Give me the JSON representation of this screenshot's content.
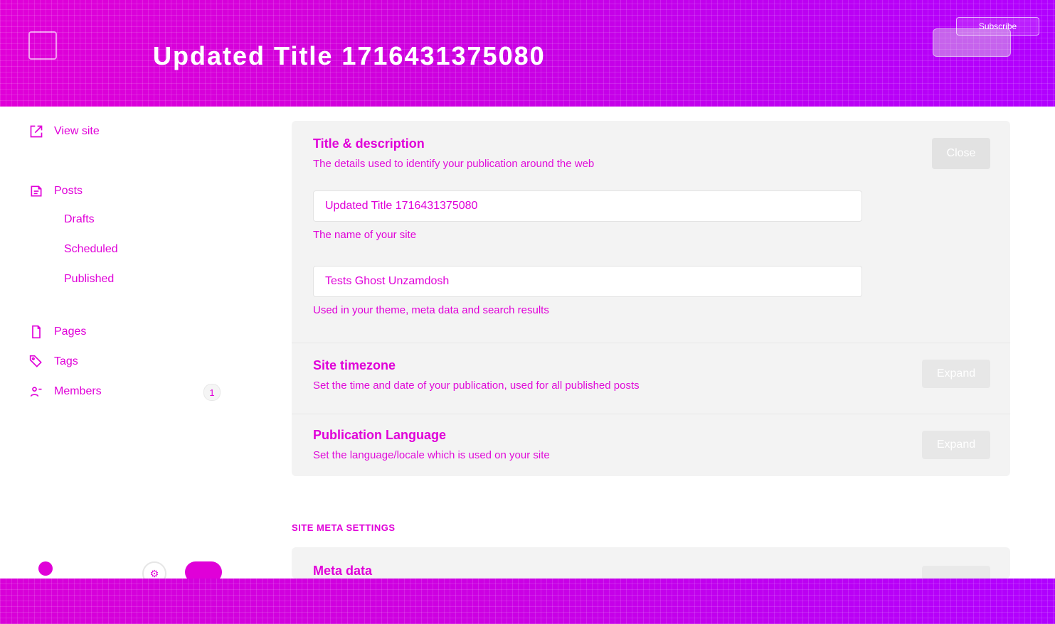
{
  "top": {
    "tiny_text": "",
    "title": "Updated Title 1716431375080",
    "subtitle": "",
    "subscribe_label": "Subscribe",
    "icon_labels": [
      "",
      "",
      ""
    ]
  },
  "sidebar": {
    "items": [
      {
        "id": "view-site",
        "label": "View site"
      },
      {
        "id": "posts",
        "label": "Posts"
      },
      {
        "id": "drafts",
        "label": "Drafts"
      },
      {
        "id": "scheduled",
        "label": "Scheduled"
      },
      {
        "id": "published",
        "label": "Published"
      },
      {
        "id": "pages",
        "label": "Pages"
      },
      {
        "id": "tags",
        "label": "Tags"
      },
      {
        "id": "members",
        "label": "Members",
        "count": "1"
      }
    ]
  },
  "main": {
    "title_section": {
      "title": "Title & description",
      "description": "The details used to identify your publication around the web",
      "close_label": "Close",
      "site_title_value": "Updated Title 1716431375080",
      "site_title_hint": "The name of your site",
      "site_description_value": "Tests Ghost Unzamdosh",
      "site_description_hint": "Used in your theme, meta data and search results"
    },
    "timezone_section": {
      "title": "Site timezone",
      "description": "Set the time and date of your publication, used for all published posts",
      "expand_label": "Expand"
    },
    "language_section": {
      "title": "Publication Language",
      "description": "Set the language/locale which is used on your site",
      "expand_label": "Expand"
    },
    "meta_settings_label": "SITE META SETTINGS",
    "meta_data_title": "Meta data"
  }
}
